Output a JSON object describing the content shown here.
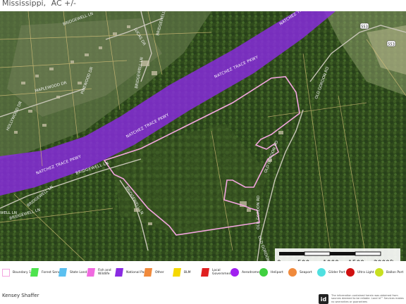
{
  "header": {
    "title_line": "Mississippi,",
    "acreage": "AC +/-"
  },
  "map": {
    "roads": [
      "NATCHEZ TRACE PKWY",
      "NATCHEZ TRACE PKWY",
      "NATCHEZ TRACE PKWY",
      "NATCHEZ TRACE PKWY",
      "BRIDGEWELL LN",
      "BRIDGEWELL LN",
      "BRIDGEWELL LN",
      "MAPLEWOOD DR",
      "HOLLYWOOD DR",
      "PINEWOOD DR",
      "LUCAS DR",
      "BRIDGEWELL LN",
      "BRIDGEWELL LN",
      "OLD GORDON RD",
      "OLD GORDON RD",
      "OLD GORDON RD",
      "OLD GORDON RD",
      "BRIDGEWELL LN",
      "WELL LN",
      "BRIDGEWELL LN"
    ],
    "shields": [
      "553",
      "553"
    ]
  },
  "scale": {
    "ticks": [
      "0",
      "500",
      "1000",
      "1500",
      "2000ft"
    ]
  },
  "legend": {
    "items": [
      {
        "label": "Boundary 1",
        "color": "#f4a6e0",
        "type": "outline"
      },
      {
        "label": "Forest Servic",
        "color": "#4de34d",
        "type": "fill"
      },
      {
        "label": "State Land",
        "color": "#5bc0f0",
        "type": "fill"
      },
      {
        "label": "Fish and Wildlife",
        "color": "#f06ae0",
        "type": "fill"
      },
      {
        "label": "National Park",
        "color": "#8a2be2",
        "type": "fill"
      },
      {
        "label": "Other",
        "color": "#f08a3c",
        "type": "fill"
      },
      {
        "label": "BLM",
        "color": "#f5d800",
        "type": "fill"
      },
      {
        "label": "Local Government",
        "color": "#e02020",
        "type": "fill"
      },
      {
        "label": "Aerodrome",
        "color": "#a020f0",
        "type": "circle"
      },
      {
        "label": "Heliport",
        "color": "#40d040",
        "type": "circle"
      },
      {
        "label": "Seaport",
        "color": "#f08a3c",
        "type": "circle"
      },
      {
        "label": "Glider Port",
        "color": "#50e0e0",
        "type": "circle"
      },
      {
        "label": "Ultra Light",
        "color": "#d01010",
        "type": "circle"
      },
      {
        "label": "Ballon Port",
        "color": "#c8e020",
        "type": "circle"
      }
    ]
  },
  "footer": {
    "agent": "Kensey Shaffer",
    "logo": "id",
    "disclaimer": "The information contained herein was obtained from sources deemed to be reliable. Land id™ Services makes no warranties or guarantees"
  }
}
